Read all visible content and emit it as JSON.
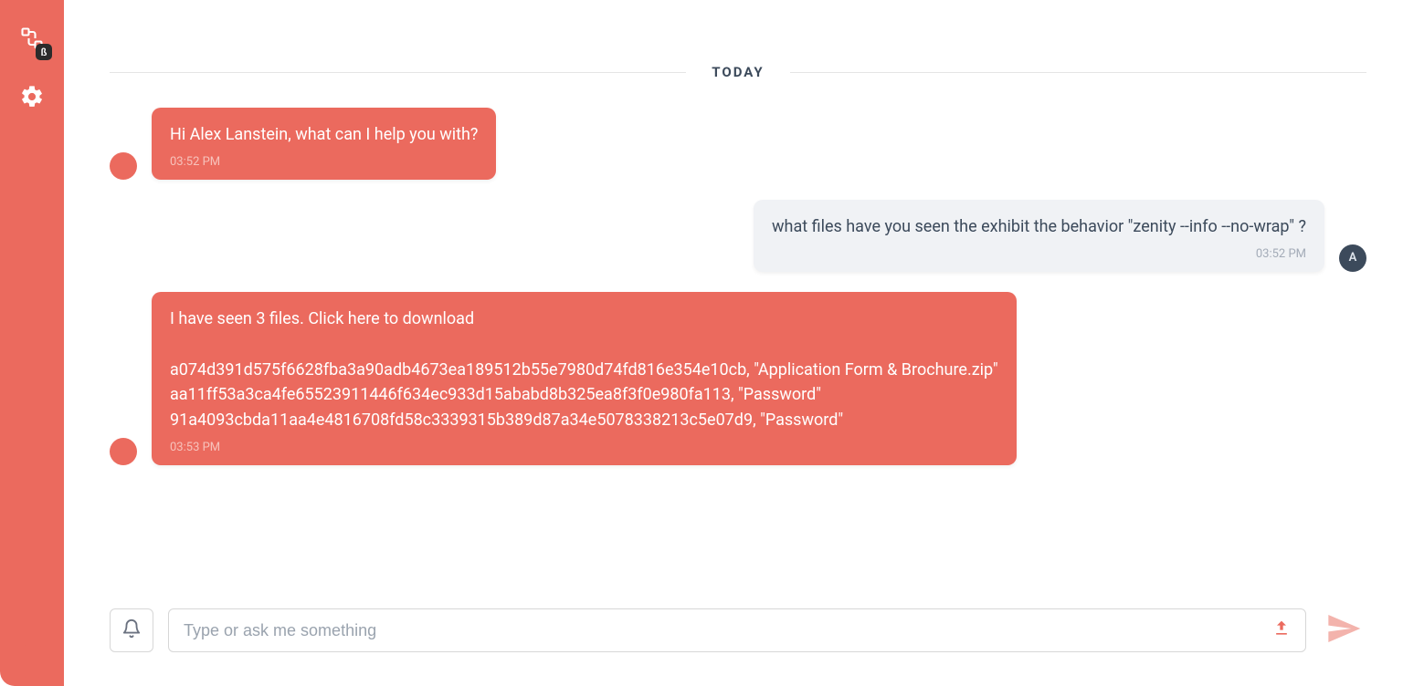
{
  "colors": {
    "accent": "#eb6a5e",
    "neutral_dark": "#3c4a5b",
    "bubble_user": "#f0f2f5"
  },
  "sidebar": {
    "beta_badge": "ß"
  },
  "divider": {
    "label": "TODAY"
  },
  "messages": {
    "bot1": {
      "text": "Hi Alex Lanstein, what can I help you with?",
      "time": "03:52 PM"
    },
    "user1": {
      "text": "what files have you seen the exhibit the behavior \"zenity --info --no-wrap\" ?",
      "time": "03:52 PM",
      "avatar_initial": "A"
    },
    "bot2": {
      "text": "I have seen 3 files. Click here to download\n\na074d391d575f6628fba3a90adb4673ea189512b55e7980d74fd816e354e10cb, \"Application Form & Brochure.zip\"\naa11ff53a3ca4fe65523911446f634ec933d15ababd8b325ea8f3f0e980fa113, \"Password\"\n91a4093cbda11aa4e4816708fd58c3339315b389d87a34e5078338213c5e07d9, \"Password\"",
      "time": "03:53 PM"
    }
  },
  "composer": {
    "placeholder": "Type or ask me something"
  }
}
